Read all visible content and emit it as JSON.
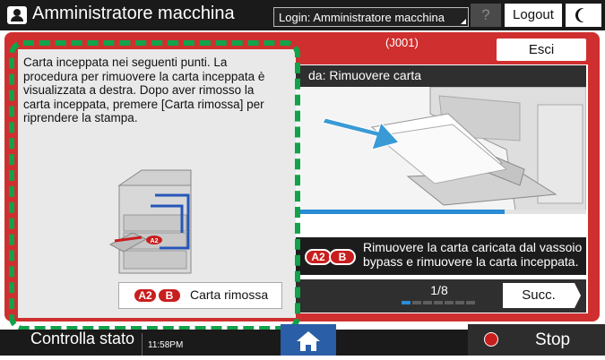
{
  "topbar": {
    "title": "Amministratore macchina",
    "login_text": "Login: Amministratore macchina",
    "help_label": "?",
    "logout_label": "Logout"
  },
  "dialog": {
    "code": "(J001)",
    "close_label": "Esci"
  },
  "left_panel": {
    "instructions": "Carta inceppata nei seguenti punti. La procedura per rimuovere la carta inceppata è visualizzata a destra. Dopo aver rimosso la carta inceppata, premere [Carta rimossa] per riprendere la stampa.",
    "printer_badge": "A2",
    "carta_button": {
      "badge_a": "A2",
      "badge_b": "B",
      "label": "Carta rimossa"
    }
  },
  "right_panel": {
    "step_title": "da: Rimuovere carta",
    "badges": [
      "A2",
      "B"
    ],
    "info_text": "Rimuovere la carta caricata dal vassoio bypass e rimuovere la carta inceppata.",
    "page_indicator": "1/8",
    "next_label": "Succ.",
    "progress_fraction": 0.72
  },
  "bottombar": {
    "status_label": "Controlla stato",
    "time": "11:58PM",
    "stop_label": "Stop"
  },
  "colors": {
    "dialog_frame": "#cf2f2f",
    "highlight_dash": "#11a24a",
    "badge_red": "#c81e1e",
    "progress_blue": "#2a8bd6",
    "home_blue": "#2a5ea6"
  },
  "icons": [
    "user-icon",
    "moon-icon",
    "home-icon",
    "stop-icon",
    "printer-icon",
    "arrow-icon"
  ]
}
